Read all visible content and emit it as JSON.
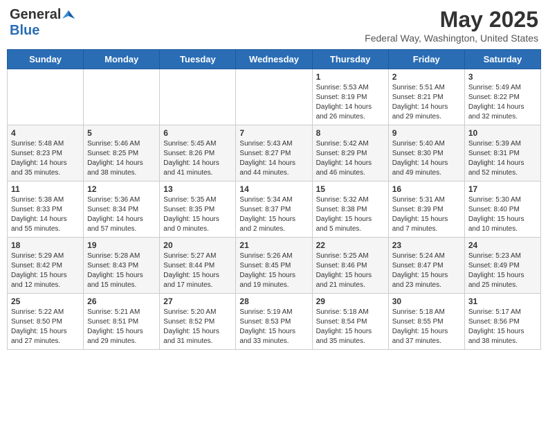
{
  "logo": {
    "line1": "General",
    "line2": "Blue"
  },
  "title": "May 2025",
  "location": "Federal Way, Washington, United States",
  "days_of_week": [
    "Sunday",
    "Monday",
    "Tuesday",
    "Wednesday",
    "Thursday",
    "Friday",
    "Saturday"
  ],
  "weeks": [
    [
      {
        "day": "",
        "info": ""
      },
      {
        "day": "",
        "info": ""
      },
      {
        "day": "",
        "info": ""
      },
      {
        "day": "",
        "info": ""
      },
      {
        "day": "1",
        "info": "Sunrise: 5:53 AM\nSunset: 8:19 PM\nDaylight: 14 hours\nand 26 minutes."
      },
      {
        "day": "2",
        "info": "Sunrise: 5:51 AM\nSunset: 8:21 PM\nDaylight: 14 hours\nand 29 minutes."
      },
      {
        "day": "3",
        "info": "Sunrise: 5:49 AM\nSunset: 8:22 PM\nDaylight: 14 hours\nand 32 minutes."
      }
    ],
    [
      {
        "day": "4",
        "info": "Sunrise: 5:48 AM\nSunset: 8:23 PM\nDaylight: 14 hours\nand 35 minutes."
      },
      {
        "day": "5",
        "info": "Sunrise: 5:46 AM\nSunset: 8:25 PM\nDaylight: 14 hours\nand 38 minutes."
      },
      {
        "day": "6",
        "info": "Sunrise: 5:45 AM\nSunset: 8:26 PM\nDaylight: 14 hours\nand 41 minutes."
      },
      {
        "day": "7",
        "info": "Sunrise: 5:43 AM\nSunset: 8:27 PM\nDaylight: 14 hours\nand 44 minutes."
      },
      {
        "day": "8",
        "info": "Sunrise: 5:42 AM\nSunset: 8:29 PM\nDaylight: 14 hours\nand 46 minutes."
      },
      {
        "day": "9",
        "info": "Sunrise: 5:40 AM\nSunset: 8:30 PM\nDaylight: 14 hours\nand 49 minutes."
      },
      {
        "day": "10",
        "info": "Sunrise: 5:39 AM\nSunset: 8:31 PM\nDaylight: 14 hours\nand 52 minutes."
      }
    ],
    [
      {
        "day": "11",
        "info": "Sunrise: 5:38 AM\nSunset: 8:33 PM\nDaylight: 14 hours\nand 55 minutes."
      },
      {
        "day": "12",
        "info": "Sunrise: 5:36 AM\nSunset: 8:34 PM\nDaylight: 14 hours\nand 57 minutes."
      },
      {
        "day": "13",
        "info": "Sunrise: 5:35 AM\nSunset: 8:35 PM\nDaylight: 15 hours\nand 0 minutes."
      },
      {
        "day": "14",
        "info": "Sunrise: 5:34 AM\nSunset: 8:37 PM\nDaylight: 15 hours\nand 2 minutes."
      },
      {
        "day": "15",
        "info": "Sunrise: 5:32 AM\nSunset: 8:38 PM\nDaylight: 15 hours\nand 5 minutes."
      },
      {
        "day": "16",
        "info": "Sunrise: 5:31 AM\nSunset: 8:39 PM\nDaylight: 15 hours\nand 7 minutes."
      },
      {
        "day": "17",
        "info": "Sunrise: 5:30 AM\nSunset: 8:40 PM\nDaylight: 15 hours\nand 10 minutes."
      }
    ],
    [
      {
        "day": "18",
        "info": "Sunrise: 5:29 AM\nSunset: 8:42 PM\nDaylight: 15 hours\nand 12 minutes."
      },
      {
        "day": "19",
        "info": "Sunrise: 5:28 AM\nSunset: 8:43 PM\nDaylight: 15 hours\nand 15 minutes."
      },
      {
        "day": "20",
        "info": "Sunrise: 5:27 AM\nSunset: 8:44 PM\nDaylight: 15 hours\nand 17 minutes."
      },
      {
        "day": "21",
        "info": "Sunrise: 5:26 AM\nSunset: 8:45 PM\nDaylight: 15 hours\nand 19 minutes."
      },
      {
        "day": "22",
        "info": "Sunrise: 5:25 AM\nSunset: 8:46 PM\nDaylight: 15 hours\nand 21 minutes."
      },
      {
        "day": "23",
        "info": "Sunrise: 5:24 AM\nSunset: 8:47 PM\nDaylight: 15 hours\nand 23 minutes."
      },
      {
        "day": "24",
        "info": "Sunrise: 5:23 AM\nSunset: 8:49 PM\nDaylight: 15 hours\nand 25 minutes."
      }
    ],
    [
      {
        "day": "25",
        "info": "Sunrise: 5:22 AM\nSunset: 8:50 PM\nDaylight: 15 hours\nand 27 minutes."
      },
      {
        "day": "26",
        "info": "Sunrise: 5:21 AM\nSunset: 8:51 PM\nDaylight: 15 hours\nand 29 minutes."
      },
      {
        "day": "27",
        "info": "Sunrise: 5:20 AM\nSunset: 8:52 PM\nDaylight: 15 hours\nand 31 minutes."
      },
      {
        "day": "28",
        "info": "Sunrise: 5:19 AM\nSunset: 8:53 PM\nDaylight: 15 hours\nand 33 minutes."
      },
      {
        "day": "29",
        "info": "Sunrise: 5:18 AM\nSunset: 8:54 PM\nDaylight: 15 hours\nand 35 minutes."
      },
      {
        "day": "30",
        "info": "Sunrise: 5:18 AM\nSunset: 8:55 PM\nDaylight: 15 hours\nand 37 minutes."
      },
      {
        "day": "31",
        "info": "Sunrise: 5:17 AM\nSunset: 8:56 PM\nDaylight: 15 hours\nand 38 minutes."
      }
    ]
  ]
}
